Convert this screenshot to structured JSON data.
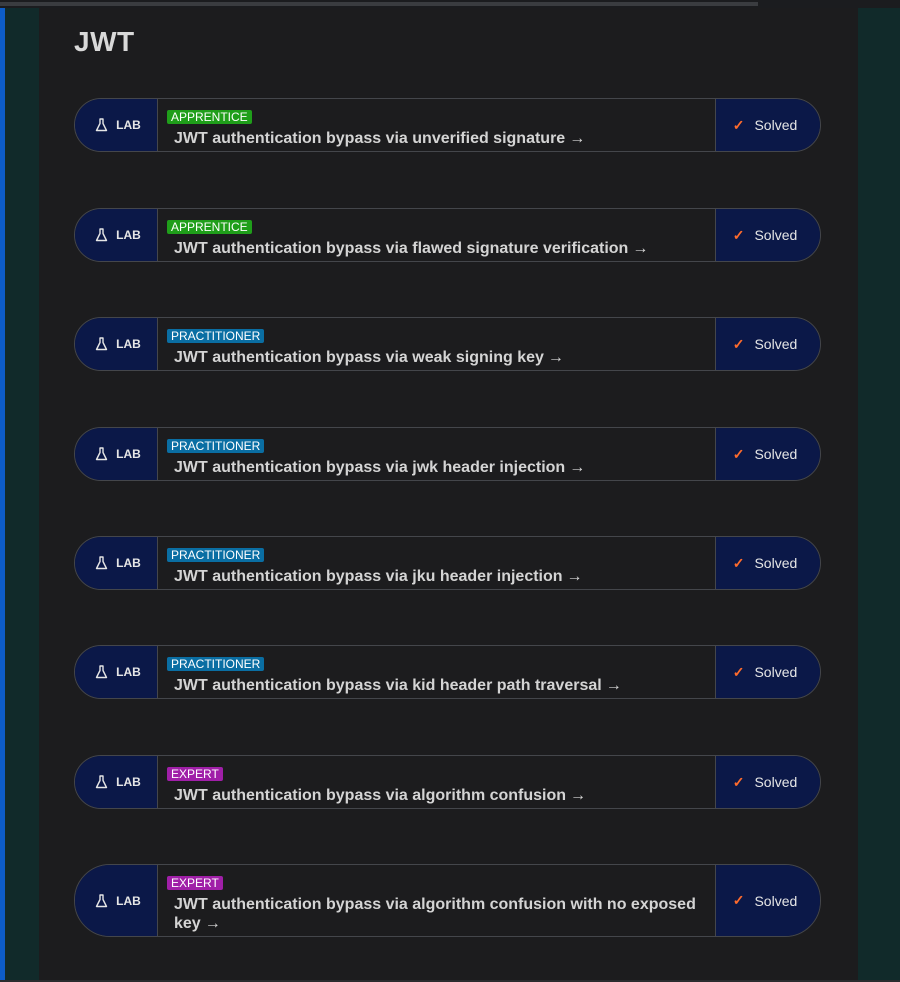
{
  "section": {
    "title": "JWT"
  },
  "labs": [
    {
      "tag": "LAB",
      "level": "APPRENTICE",
      "title": "JWT authentication bypass via unverified signature",
      "arrow": "→",
      "status": "Solved"
    },
    {
      "tag": "LAB",
      "level": "APPRENTICE",
      "title": "JWT authentication bypass via flawed signature verification",
      "arrow": "→",
      "status": "Solved"
    },
    {
      "tag": "LAB",
      "level": "PRACTITIONER",
      "title": "JWT authentication bypass via weak signing key",
      "arrow": "→",
      "status": "Solved"
    },
    {
      "tag": "LAB",
      "level": "PRACTITIONER",
      "title": "JWT authentication bypass via jwk header injection",
      "arrow": "→",
      "status": "Solved"
    },
    {
      "tag": "LAB",
      "level": "PRACTITIONER",
      "title": "JWT authentication bypass via jku header injection",
      "arrow": "→",
      "status": "Solved"
    },
    {
      "tag": "LAB",
      "level": "PRACTITIONER",
      "title": "JWT authentication bypass via kid header path traversal",
      "arrow": "→",
      "status": "Solved"
    },
    {
      "tag": "LAB",
      "level": "EXPERT",
      "title": "JWT authentication bypass via algorithm confusion",
      "arrow": "→",
      "status": "Solved"
    },
    {
      "tag": "LAB",
      "level": "EXPERT",
      "title": "JWT authentication bypass via algorithm confusion with no exposed key",
      "arrow": "→",
      "status": "Solved"
    }
  ],
  "icons": {
    "lab": "flask-icon",
    "status": "checkmark-icon",
    "link": "arrow-right-icon"
  },
  "colors": {
    "apprentice": "#1f9e1a",
    "practitioner": "#0a6ea3",
    "expert": "#a01fa8",
    "check": "#ff6b2c",
    "tag_bg": "#0b1848"
  }
}
